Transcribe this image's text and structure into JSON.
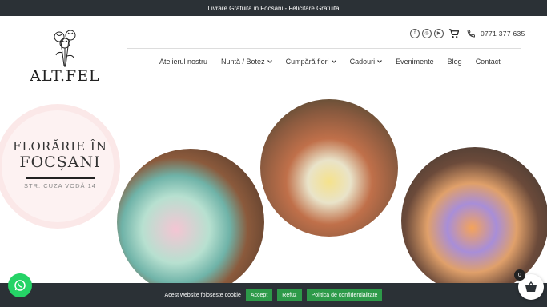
{
  "topbar": {
    "text": "Livrare Gratuita in Focsani - Felicitare Gratuita"
  },
  "logo": {
    "text": "ALT.FEL"
  },
  "header": {
    "social": [
      "facebook-icon",
      "instagram-icon",
      "youtube-icon"
    ],
    "phone": "0771 377 635"
  },
  "nav": {
    "items": [
      {
        "label": "Atelierul nostru"
      },
      {
        "label": "Nuntă / Botez"
      },
      {
        "label": "Cumpără flori"
      },
      {
        "label": "Cadouri"
      },
      {
        "label": "Evenimente"
      },
      {
        "label": "Blog"
      },
      {
        "label": "Contact"
      }
    ]
  },
  "badge": {
    "line1": "FLORĂRIE ÎN",
    "line2": "FOCȘANI",
    "address": "STR. CUZA VODĂ 14"
  },
  "cookie": {
    "text": "Acest website foloseste cookie",
    "accept": "Accept",
    "refuse": "Refuz",
    "policy": "Politica de confidentialitate"
  },
  "cart": {
    "count": "0"
  }
}
